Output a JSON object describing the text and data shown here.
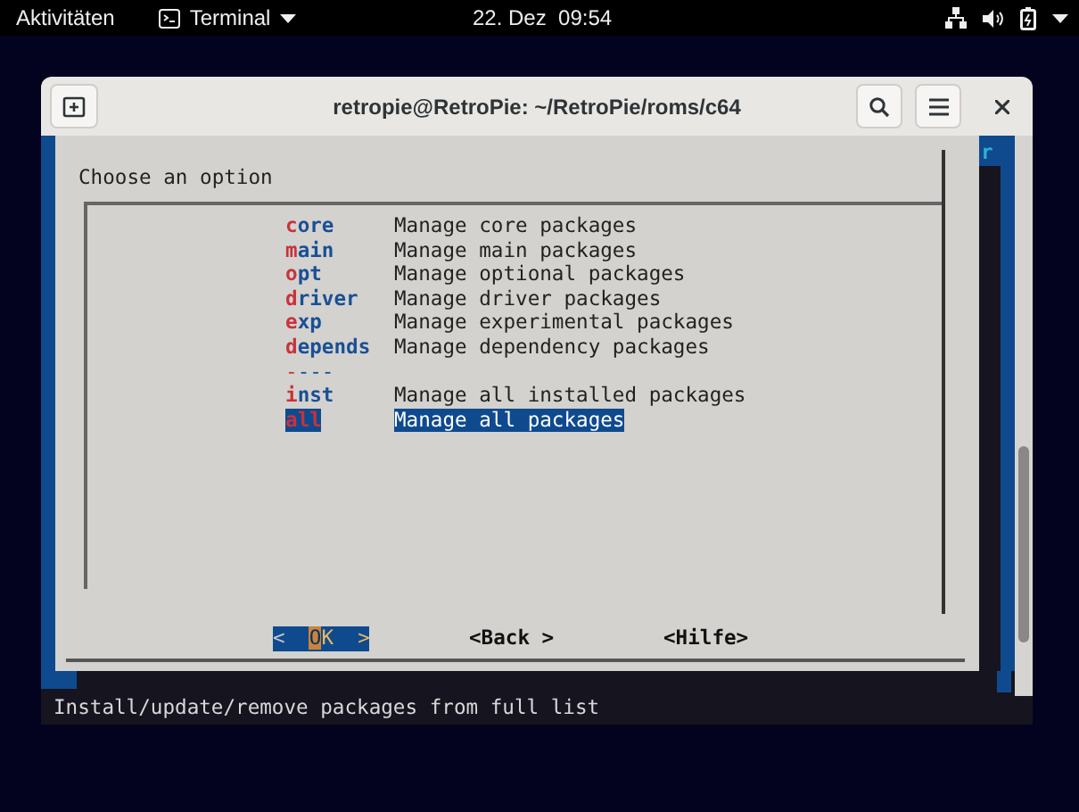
{
  "top_bar": {
    "activities": "Aktivitäten",
    "app": "Terminal",
    "clock": "22. Dez  09:54"
  },
  "window": {
    "title": "retropie@RetroPie: ~/RetroPie/roms/c64"
  },
  "side_column": {
    "text": "r"
  },
  "dialog": {
    "prompt": "Choose an option",
    "items": [
      {
        "kind": "option",
        "key": "core",
        "description": "Manage core packages",
        "selected": false
      },
      {
        "kind": "option",
        "key": "main",
        "description": "Manage main packages",
        "selected": false
      },
      {
        "kind": "option",
        "key": "opt",
        "description": "Manage optional packages",
        "selected": false
      },
      {
        "kind": "option",
        "key": "driver",
        "description": "Manage driver packages",
        "selected": false
      },
      {
        "kind": "option",
        "key": "exp",
        "description": "Manage experimental packages",
        "selected": false
      },
      {
        "kind": "option",
        "key": "depends",
        "description": "Manage dependency packages",
        "selected": false
      },
      {
        "kind": "separator",
        "key": "----"
      },
      {
        "kind": "option",
        "key": "inst",
        "description": "Manage all installed packages",
        "selected": false
      },
      {
        "kind": "option",
        "key": "all",
        "description": "Manage all packages",
        "selected": true
      }
    ],
    "buttons": [
      {
        "label": "<  OK  >",
        "selected": true
      },
      {
        "label": "<Back >",
        "selected": false
      },
      {
        "label": "<Hilfe>",
        "selected": false
      }
    ]
  },
  "status_line": "Install/update/remove packages from full list"
}
